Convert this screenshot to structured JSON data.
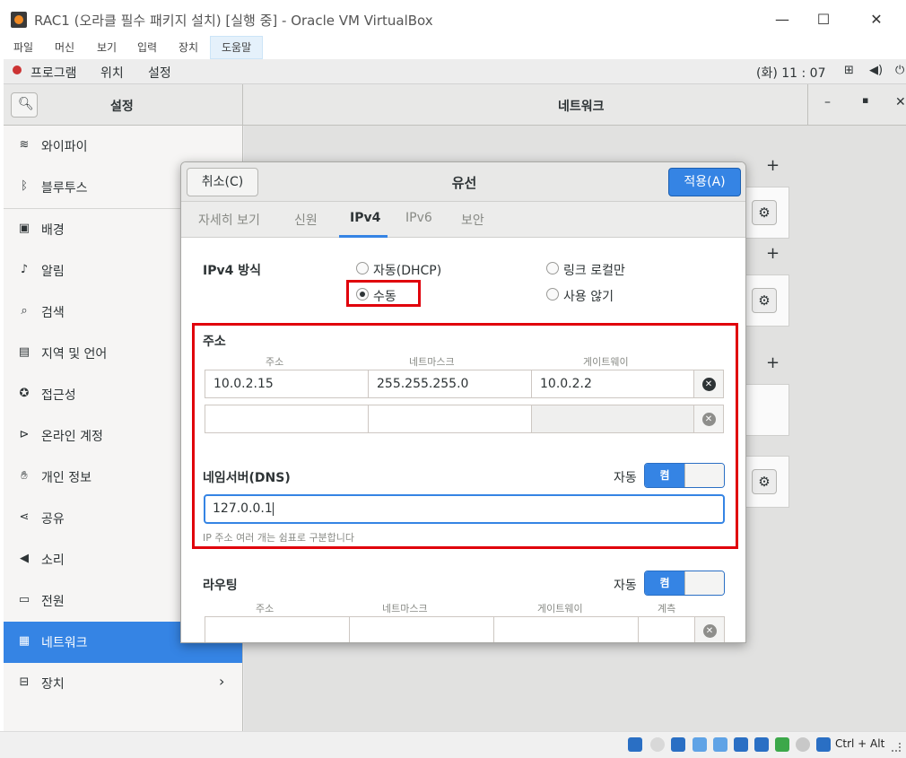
{
  "window": {
    "title": "RAC1 (오라클 필수 패키지 설치) [실행 중] - Oracle VM VirtualBox",
    "menu": [
      "파일",
      "머신",
      "보기",
      "입력",
      "장치",
      "도움말"
    ]
  },
  "guest_topbar": {
    "items": [
      "프로그램",
      "위치",
      "설정"
    ],
    "clock": "(화) 11 : 07"
  },
  "settings_header": {
    "left_title": "설정",
    "right_title": "네트워크"
  },
  "sidebar": {
    "items": [
      {
        "label": "와이파이",
        "icon": "wifi-icon"
      },
      {
        "label": "블루투스",
        "icon": "bluetooth-icon"
      },
      {
        "label": "배경",
        "icon": "background-icon"
      },
      {
        "label": "알림",
        "icon": "bell-icon"
      },
      {
        "label": "검색",
        "icon": "search-icon"
      },
      {
        "label": "지역 및 언어",
        "icon": "region-icon"
      },
      {
        "label": "접근성",
        "icon": "accessibility-icon"
      },
      {
        "label": "온라인 계정",
        "icon": "online-accounts-icon"
      },
      {
        "label": "개인 정보",
        "icon": "hand-icon"
      },
      {
        "label": "공유",
        "icon": "share-icon"
      },
      {
        "label": "소리",
        "icon": "speaker-icon"
      },
      {
        "label": "전원",
        "icon": "power-icon"
      },
      {
        "label": "네트워크",
        "icon": "network-icon"
      },
      {
        "label": "장치",
        "icon": "devices-icon"
      }
    ],
    "active": "네트워크"
  },
  "dialog": {
    "cancel_label": "취소(C)",
    "title": "유선",
    "apply_label": "적용(A)",
    "tabs": [
      "자세히 보기",
      "신원",
      "IPv4",
      "IPv6",
      "보안"
    ],
    "active_tab": "IPv4",
    "ipv4_method_label": "IPv4 방식",
    "methods": {
      "dhcp": "자동(DHCP)",
      "link_local": "링크 로컬만",
      "manual": "수동",
      "disabled": "사용 않기"
    },
    "selected_method": "수동",
    "address_section": {
      "title": "주소",
      "col_address": "주소",
      "col_netmask": "네트마스크",
      "col_gateway": "게이트웨이",
      "row1": {
        "address": "10.0.2.15",
        "netmask": "255.255.255.0",
        "gateway": "10.0.2.2"
      },
      "row2": {
        "address": "",
        "netmask": "",
        "gateway": ""
      }
    },
    "dns_section": {
      "title": "네임서버(DNS)",
      "auto_label": "자동",
      "toggle_label": "켬",
      "value": "127.0.0.1",
      "hint": "IP 주소 여러 개는 쉼표로 구분합니다"
    },
    "routing_section": {
      "title": "라우팅",
      "auto_label": "자동",
      "toggle_label": "켬",
      "col_address": "주소",
      "col_netmask": "네트마스크",
      "col_gateway": "게이트웨이",
      "col_metric": "계측"
    }
  },
  "host_status": {
    "keys": "Ctrl + Alt"
  },
  "colors": {
    "accent": "#3584e4",
    "highlight_red": "#e0000b"
  }
}
